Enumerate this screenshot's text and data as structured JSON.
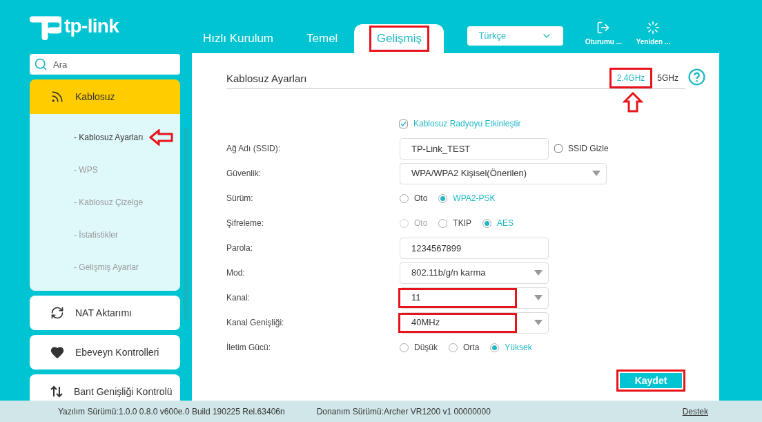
{
  "logo": {
    "text": "tp-link"
  },
  "tabs": [
    {
      "label": "Hızlı Kurulum",
      "selected": false,
      "annotated": false
    },
    {
      "label": "Temel",
      "selected": false,
      "annotated": false
    },
    {
      "label": "Gelişmiş",
      "selected": true,
      "annotated": true
    }
  ],
  "language": {
    "value": "Türkçe"
  },
  "header_actions": [
    {
      "kind": "logout",
      "label": "Oturumu ..."
    },
    {
      "kind": "reboot",
      "label": "Yeniden ..."
    }
  ],
  "sidebar": {
    "search": {
      "placeholder": "Ara"
    },
    "items": [
      {
        "kind": "wifi",
        "label": "Kablosuz",
        "expanded": true,
        "children": [
          {
            "label": "- Kablosuz Ayarları",
            "selected": true,
            "annotated": true
          },
          {
            "label": "- WPS",
            "selected": false,
            "annotated": false
          },
          {
            "label": "- Kablosuz Çizelge",
            "selected": false,
            "annotated": false
          },
          {
            "label": "- İstatistikler",
            "selected": false,
            "annotated": false
          },
          {
            "label": "- Gelişmiş Ayarlar",
            "selected": false,
            "annotated": false
          }
        ]
      },
      {
        "kind": "nat",
        "label": "NAT Aktarımı",
        "expanded": false
      },
      {
        "kind": "heart",
        "label": "Ebeveyn Kontrolleri",
        "expanded": false
      },
      {
        "kind": "updown",
        "label": "Bant Genişliği Kontrolü",
        "expanded": false
      }
    ]
  },
  "panel": {
    "title": "Kablosuz Ayarları",
    "bands": [
      {
        "label": "2.4GHz",
        "selected": true,
        "annotated": true
      },
      {
        "label": "5GHz",
        "selected": false,
        "annotated": false
      }
    ],
    "rows": [
      {
        "kind": "checkbox",
        "label": "Kablosuz Radyoyu Etkinleştir",
        "checked": true
      },
      {
        "kind": "text",
        "label": "Ağ Adı (SSID):",
        "value": "TP-Link_TEST",
        "annotated": false,
        "extra": {
          "label": "SSID Gizle",
          "checked": false
        }
      },
      {
        "kind": "select",
        "label": "Güvenlik:",
        "value": "WPA/WPA2 Kişisel(Önerilen)",
        "wide": true,
        "annotated": false
      },
      {
        "kind": "radio",
        "label": "Sürüm:",
        "options": [
          {
            "label": "Oto",
            "selected": false,
            "disabled": false
          },
          {
            "label": "WPA2-PSK",
            "selected": true,
            "disabled": false
          }
        ]
      },
      {
        "kind": "radio",
        "label": "Şifreleme:",
        "options": [
          {
            "label": "Oto",
            "selected": false,
            "disabled": true
          },
          {
            "label": "TKIP",
            "selected": false,
            "disabled": false
          },
          {
            "label": "AES",
            "selected": true,
            "disabled": false
          }
        ]
      },
      {
        "kind": "text",
        "label": "Parola:",
        "value": "1234567899",
        "annotated": false
      },
      {
        "kind": "select",
        "label": "Mod:",
        "value": "802.11b/g/n karma",
        "wide": false,
        "annotated": false
      },
      {
        "kind": "select",
        "label": "Kanal:",
        "value": "11",
        "wide": false,
        "annotated": true
      },
      {
        "kind": "select",
        "label": "Kanal Genişliği:",
        "value": "40MHz",
        "wide": false,
        "annotated": true
      },
      {
        "kind": "radio",
        "label": "İletim Gücü:",
        "options": [
          {
            "label": "Düşük",
            "selected": false,
            "disabled": false
          },
          {
            "label": "Orta",
            "selected": false,
            "disabled": false
          },
          {
            "label": "Yüksek",
            "selected": true,
            "disabled": false
          }
        ]
      }
    ],
    "save": {
      "label": "Kaydet",
      "annotated": true
    }
  },
  "footer": {
    "software": "Yazılım Sürümü:1.0.0 0.8.0 v600e.0 Build 190225 Rel.63406n",
    "hardware": "Donanım Sürümü:Archer VR1200 v1 00000000",
    "link": "Destek"
  }
}
